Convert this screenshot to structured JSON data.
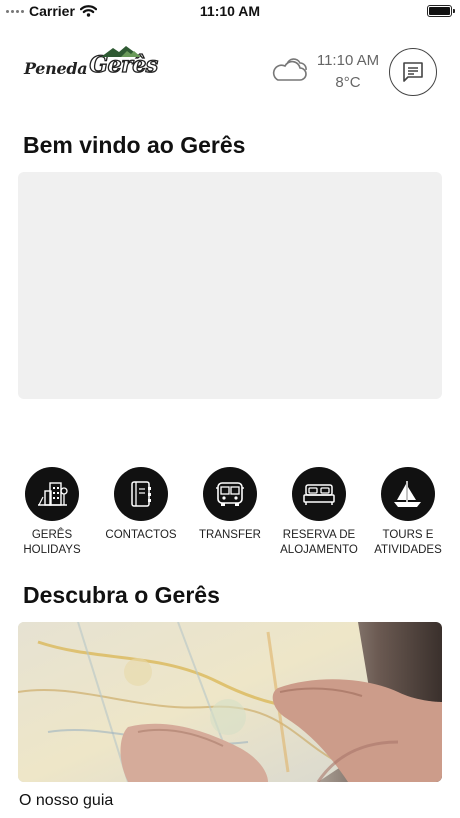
{
  "status_bar": {
    "carrier": "Carrier",
    "time": "11:10 AM",
    "icons": [
      "signal-dots",
      "wifi-icon",
      "battery-icon"
    ]
  },
  "header": {
    "logo": {
      "word1": "Peneda",
      "word2": "Gerês"
    },
    "weather_icon": "cloud-icon",
    "time": "11:10 AM",
    "temperature": "8°C",
    "chat_icon": "message-icon"
  },
  "welcome": {
    "title": "Bem vindo ao Gerês"
  },
  "services": [
    {
      "label": "GERÊS\nHOLIDAYS",
      "icon": "hotel-icon"
    },
    {
      "label": "CONTACTOS",
      "icon": "address-book-icon"
    },
    {
      "label": "TRANSFER",
      "icon": "bus-icon"
    },
    {
      "label": "RESERVA DE\nALOJAMENTO",
      "icon": "bed-icon"
    },
    {
      "label": "TOURS E\nATIVIDADES",
      "icon": "sailboat-icon"
    }
  ],
  "discover": {
    "title": "Descubra o Gerês",
    "card": {
      "caption": "O nosso guia",
      "image": "map-in-hands-photo"
    }
  },
  "colors": {
    "background": "#ffffff",
    "icon_circle": "#111111",
    "placeholder": "#f0f0f0"
  }
}
